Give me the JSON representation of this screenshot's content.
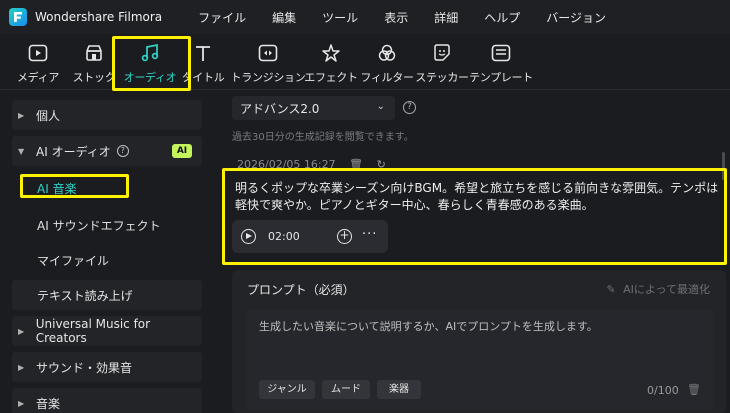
{
  "app": {
    "title": "Wondershare Filmora"
  },
  "menu": [
    "ファイル",
    "編集",
    "ツール",
    "表示",
    "詳細",
    "ヘルプ",
    "バージョン"
  ],
  "toolbar": [
    {
      "label": "メディア",
      "icon": "media-icon"
    },
    {
      "label": "ストック",
      "icon": "stock-icon"
    },
    {
      "label": "オーディオ",
      "icon": "audio-icon",
      "active": true
    },
    {
      "label": "タイトル",
      "icon": "title-icon"
    },
    {
      "label": "トランジション",
      "icon": "transition-icon"
    },
    {
      "label": "エフェクト",
      "icon": "effect-icon"
    },
    {
      "label": "フィルター",
      "icon": "filter-icon"
    },
    {
      "label": "ステッカー",
      "icon": "sticker-icon"
    },
    {
      "label": "テンプレート",
      "icon": "template-icon"
    }
  ],
  "sidebar": {
    "personal": "個人",
    "ai_audio": "AI オーディオ",
    "ai_badge": "AI",
    "ai_music": "AI 音楽",
    "ai_sound_effect": "AI サウンドエフェクト",
    "my_files": "マイファイル",
    "tts": "テキスト読み上げ",
    "universal_music": "Universal Music for Creators",
    "sound_effects": "サウンド・効果音",
    "music": "音楽"
  },
  "main": {
    "model_select": "アドバンス2.0",
    "history_note": "過去30日分の生成記録を閲覧できます。",
    "entry_time": "2026/02/05 16:27",
    "generated_text": "明るくポップな卒業シーズン向けBGM。希望と旅立ちを感じる前向きな雰囲気。テンポは軽快で爽やか。ピアノとギター中心、春らしく青春感のある楽曲。",
    "duration": "02:00",
    "more": "···",
    "prompt_label": "プロンプト（必須）",
    "optimize_label": "AIによって最適化",
    "prompt_placeholder": "生成したい音楽について説明するか、AIでプロンプトを生成します。",
    "chips": [
      "ジャンル",
      "ムード",
      "楽器"
    ],
    "counter": "0/100"
  },
  "colors": {
    "accent": "#32d3c6",
    "highlight": "#fff200",
    "ai_badge": "#c5f35a"
  }
}
